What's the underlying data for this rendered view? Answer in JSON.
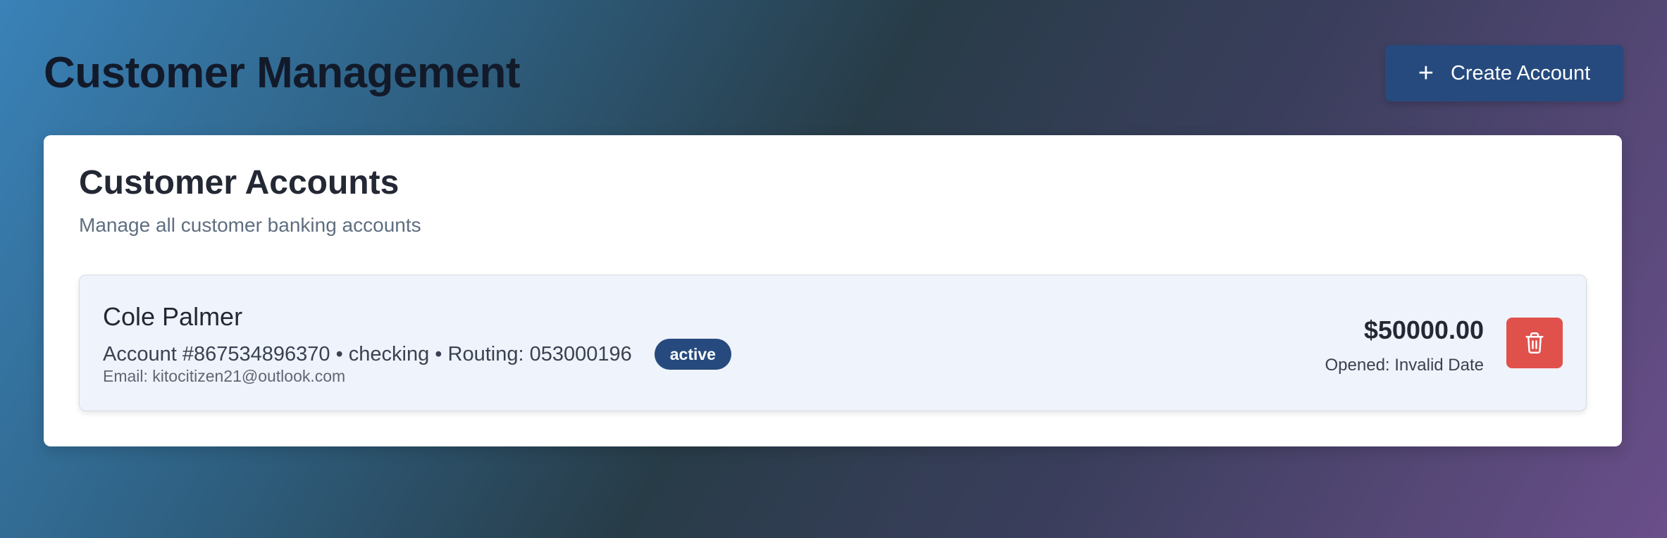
{
  "header": {
    "title": "Customer Management",
    "create_button_label": "Create Account",
    "create_button_icon": "plus-icon"
  },
  "card": {
    "title": "Customer Accounts",
    "subtitle": "Manage all customer banking accounts"
  },
  "accounts": [
    {
      "name": "Cole Palmer",
      "details": "Account #867534896370 • checking • Routing: 053000196",
      "status": "active",
      "email": "Email: kitocitizen21@outlook.com",
      "balance": "$50000.00",
      "opened": "Opened: Invalid Date",
      "delete_icon": "trash-icon"
    }
  ],
  "colors": {
    "primary": "#264a7e",
    "danger": "#e0514c",
    "row_background": "#eff3fb"
  }
}
